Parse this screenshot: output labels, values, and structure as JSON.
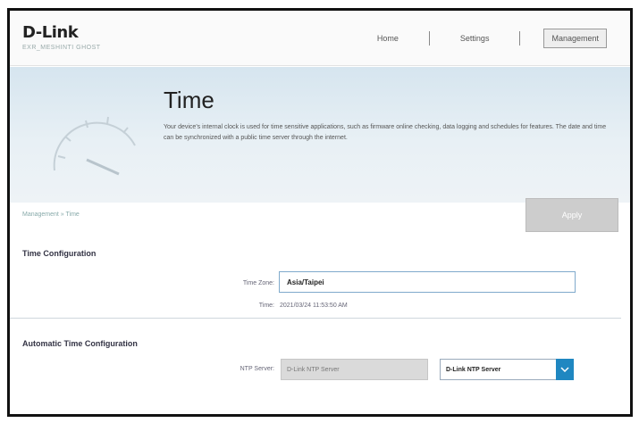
{
  "header": {
    "logo": "D-Link",
    "logo_sub": "EXR_MESHINTI GHOST",
    "nav": [
      {
        "label": "Home"
      },
      {
        "label": "Settings"
      },
      {
        "label": "Management"
      }
    ]
  },
  "hero": {
    "title": "Time",
    "description": "Your device's internal clock is used for time sensitive applications, such as firmware online checking, data logging and schedules for features. The date and time can be synchronized with a public time server through the internet."
  },
  "breadcrumb": "Management » Time",
  "apply_label": "Apply",
  "time_config": {
    "title": "Time Configuration",
    "timezone_label": "Time Zone:",
    "timezone_value": "Asia/Taipei",
    "time_label": "Time:",
    "time_value": "2021/03/24 11:53:50 AM"
  },
  "auto_config": {
    "title": "Automatic Time Configuration",
    "ntp_label": "NTP Server:",
    "ntp_input_value": "D-Link NTP Server",
    "ntp_select_value": "D-Link NTP Server"
  },
  "colors": {
    "accent": "#1f87c1",
    "hero_bg": "#dfe9f0"
  }
}
